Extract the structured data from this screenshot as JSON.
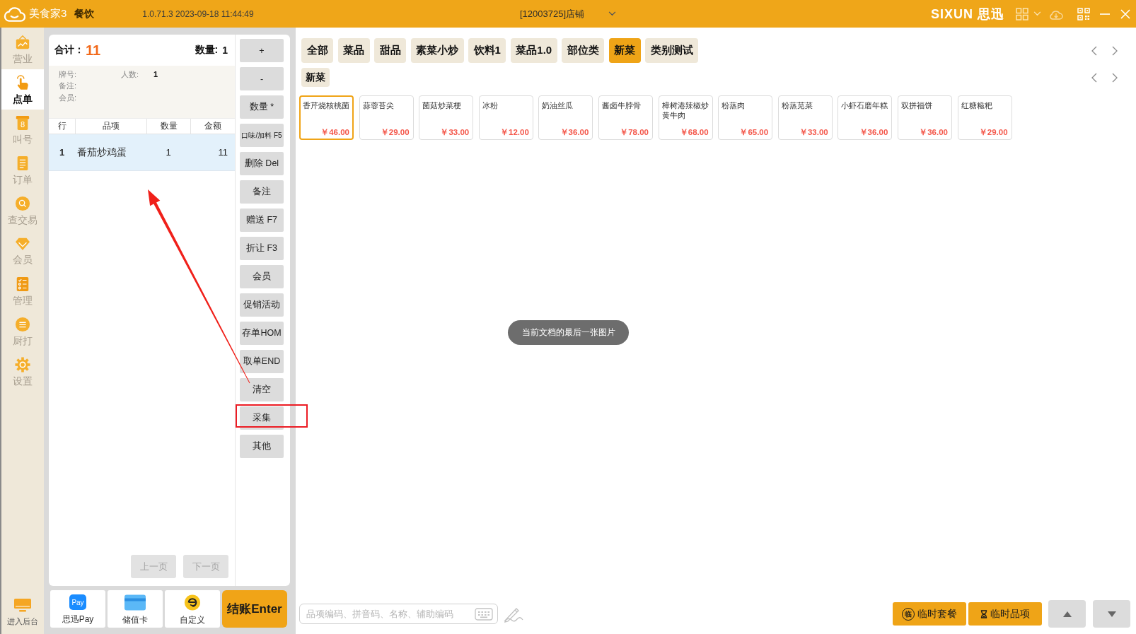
{
  "window": {
    "app_name": "美食家3",
    "module": "餐饮",
    "version": "1.0.71.3 2023-09-18 11:44:49",
    "store": "[12003725]店铺",
    "brand": "SIXUN 思迅"
  },
  "sidebar": {
    "items": [
      {
        "label": "营业",
        "kind": "business",
        "selected": false
      },
      {
        "label": "点单",
        "kind": "order",
        "selected": true
      },
      {
        "label": "叫号",
        "kind": "call",
        "icon_text": "8",
        "selected": false
      },
      {
        "label": "订单",
        "kind": "list",
        "selected": false
      },
      {
        "label": "查交易",
        "kind": "search",
        "selected": false
      },
      {
        "label": "会员",
        "kind": "member",
        "selected": false
      },
      {
        "label": "管理",
        "kind": "manage",
        "selected": false
      },
      {
        "label": "厨打",
        "kind": "print",
        "selected": false
      },
      {
        "label": "设置",
        "kind": "settings",
        "selected": false
      }
    ],
    "footer": {
      "label": "进入后台"
    }
  },
  "order": {
    "total_label": "合计：",
    "total": "11",
    "quantity_label": "数量:",
    "quantity": "1",
    "info_rows": [
      [
        {
          "label": "牌号:"
        },
        {
          "label": "人数:",
          "value": "1"
        }
      ],
      [
        {
          "label": "备注:"
        }
      ],
      [
        {
          "label": "会员:"
        }
      ]
    ],
    "columns": [
      "行",
      "品项",
      "数量",
      "金额"
    ],
    "rows": [
      {
        "cells": [
          "1",
          "番茄炒鸡蛋",
          "1",
          "11"
        ],
        "selected": true
      }
    ],
    "pager": [
      {
        "label": "上一页",
        "disabled": true
      },
      {
        "label": "下一页",
        "disabled": true
      }
    ]
  },
  "actions": [
    {
      "label": "+",
      "highlighted": false
    },
    {
      "label": "-",
      "highlighted": false
    },
    {
      "label": "数量 *",
      "highlighted": false
    },
    {
      "label": "口味/加料 F5",
      "highlighted": false
    },
    {
      "label": "删除 Del",
      "highlighted": false
    },
    {
      "label": "备注",
      "highlighted": false
    },
    {
      "label": "赠送 F7",
      "highlighted": false
    },
    {
      "label": "折让 F3",
      "highlighted": false
    },
    {
      "label": "会员",
      "highlighted": false
    },
    {
      "label": "促销活动",
      "highlighted": false
    },
    {
      "label": "存单HOM",
      "highlighted": false
    },
    {
      "label": "取单END",
      "highlighted": false
    },
    {
      "label": "清空",
      "highlighted": false
    },
    {
      "label": "采集",
      "highlighted": true
    },
    {
      "label": "其他",
      "highlighted": false
    }
  ],
  "payments": [
    {
      "label": "思迅Pay",
      "kind": "pay",
      "logo_text": "Pay"
    },
    {
      "label": "储值卡",
      "kind": "card"
    },
    {
      "label": "自定义",
      "kind": "custom"
    }
  ],
  "checkout": {
    "label": "结账Enter"
  },
  "categories": [
    {
      "tabs": [
        {
          "label": "全部",
          "selected": false
        },
        {
          "label": "菜品",
          "selected": false
        },
        {
          "label": "甜品",
          "selected": false
        },
        {
          "label": "素菜小炒",
          "selected": false
        },
        {
          "label": "饮料1",
          "selected": false
        },
        {
          "label": "菜品1.0",
          "selected": false
        },
        {
          "label": "部位类",
          "selected": false
        },
        {
          "label": "新菜",
          "selected": true
        },
        {
          "label": "类别测试",
          "selected": false
        }
      ]
    },
    {
      "tabs": [
        {
          "label": "新菜",
          "selected": false
        }
      ]
    }
  ],
  "dishes": [
    {
      "name": "香芹烧核桃菌",
      "price": "￥46.00",
      "selected": true
    },
    {
      "name": "蒜蓉苔尖",
      "price": "￥29.00",
      "selected": false
    },
    {
      "name": "菌菇炒菜梗",
      "price": "￥33.00",
      "selected": false
    },
    {
      "name": "冰粉",
      "price": "￥12.00",
      "selected": false
    },
    {
      "name": "奶油丝瓜",
      "price": "￥36.00",
      "selected": false
    },
    {
      "name": "酱卤牛脖骨",
      "price": "￥78.00",
      "selected": false
    },
    {
      "name": "樟树港辣椒炒黄牛肉",
      "price": "￥68.00",
      "selected": false
    },
    {
      "name": "粉蒸肉",
      "price": "￥65.00",
      "selected": false
    },
    {
      "name": "粉蒸苋菜",
      "price": "￥33.00",
      "selected": false
    },
    {
      "name": "小虾石磨年糕",
      "price": "￥36.00",
      "selected": false
    },
    {
      "name": "双拼福饼",
      "price": "￥36.00",
      "selected": false
    },
    {
      "name": "红糖糍粑",
      "price": "￥29.00",
      "selected": false
    }
  ],
  "search": {
    "placeholder": "品项编码、拼音码、名称、辅助编码"
  },
  "quick_buttons": [
    {
      "label": "临时套餐",
      "kind": "combo",
      "icon_text": "临"
    },
    {
      "label": "临时品项",
      "kind": "item"
    }
  ],
  "toast": {
    "text": "当前文档的最后一张图片"
  },
  "annotations": {
    "arrow": true
  }
}
